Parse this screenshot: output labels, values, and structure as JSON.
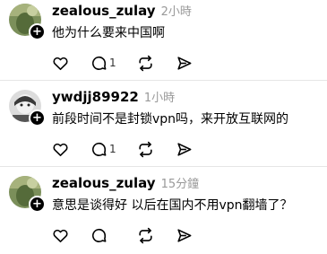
{
  "comments": [
    {
      "username": "zealous_zulay",
      "time": "2小時",
      "text": "他为什么要来中国啊",
      "reply_count": "1",
      "avatar_plus": "+"
    },
    {
      "username": "ywdjj89922",
      "time": "1小時",
      "text": "前段时间不是封锁vpn吗，来开放互联网的",
      "reply_count": "1",
      "avatar_plus": "+"
    },
    {
      "username": "zealous_zulay",
      "time": "15分鐘",
      "text": "意思是谈得好 以后在国内不用vpn翻墙了？",
      "reply_count": "",
      "avatar_plus": "+"
    }
  ],
  "icons": [
    "heart-icon",
    "comment-icon",
    "repost-icon",
    "share-icon"
  ],
  "colors": {
    "text": "#000000",
    "muted": "#999999",
    "divider": "#e6e6e6"
  }
}
